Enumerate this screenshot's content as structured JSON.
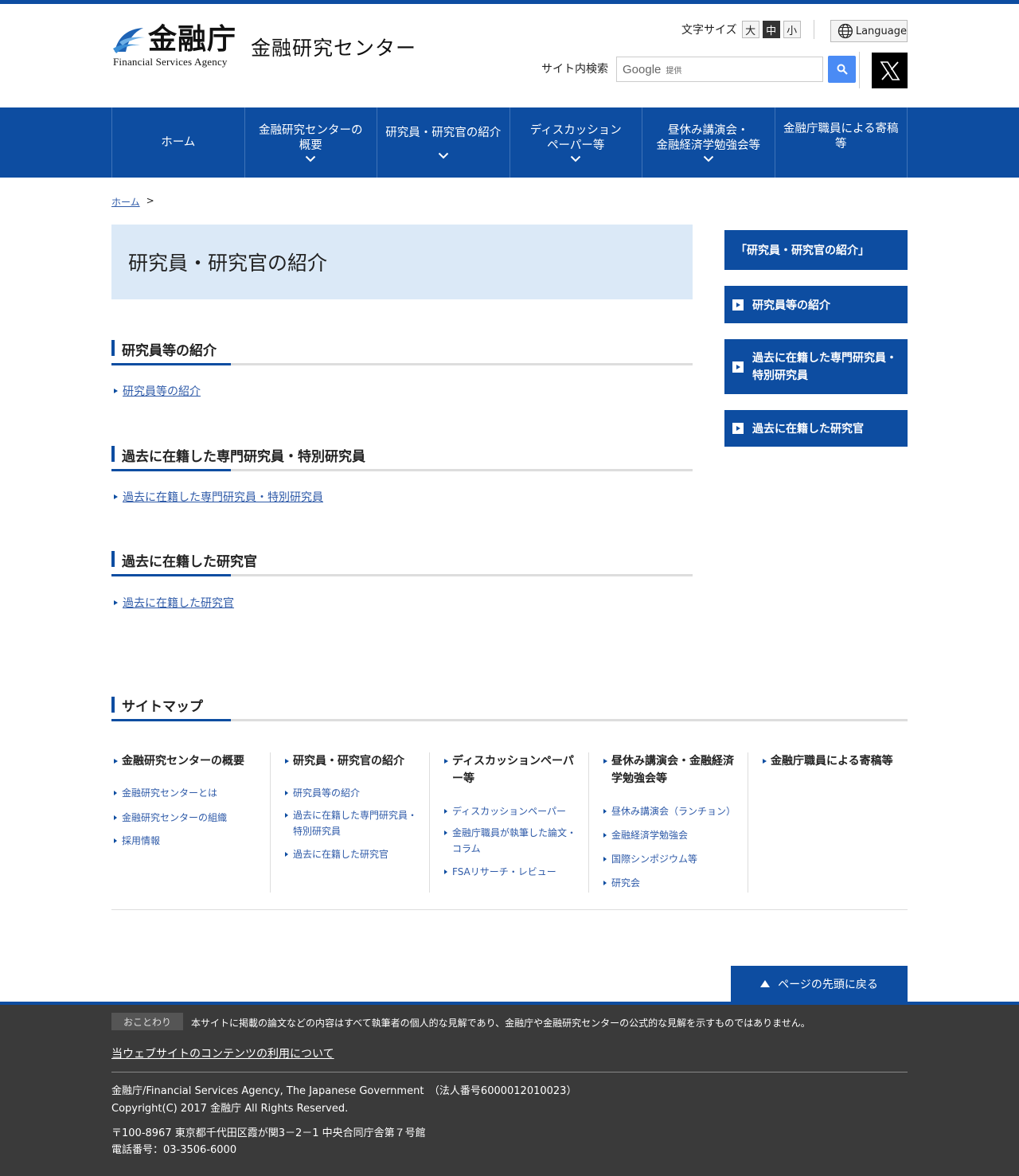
{
  "header": {
    "logo_kanji": "金融庁",
    "logo_en": "Financial Services Agency",
    "logo_center": "金融研究センター",
    "fontsize_label": "文字サイズ",
    "fontsize_options": [
      "大",
      "中",
      "小"
    ],
    "language_label": "Language",
    "search_label": "サイト内検索",
    "search_brand": "Google",
    "search_provided": "提供"
  },
  "nav": {
    "items": [
      {
        "label": "ホーム"
      },
      {
        "label": "金融研究センターの\n概要"
      },
      {
        "label": "研究員・研究官の紹介"
      },
      {
        "label": "ディスカッション\nペーパー等"
      },
      {
        "label": "昼休み講演会・\n金融経済学勉強会等"
      },
      {
        "label": "金融庁職員による寄稿\n等"
      }
    ]
  },
  "breadcrumb": {
    "home": "ホーム",
    "sep": ">"
  },
  "main": {
    "title": "研究員・研究官の紹介",
    "sections": [
      {
        "heading": "研究員等の紹介",
        "link": "研究員等の紹介"
      },
      {
        "heading": "過去に在籍した専門研究員・特別研究員",
        "link": "過去に在籍した専門研究員・特別研究員"
      },
      {
        "heading": "過去に在籍した研究官",
        "link": "過去に在籍した研究官"
      }
    ]
  },
  "sidebar": {
    "header": "「研究員・研究官の紹介」",
    "items": [
      {
        "label": "研究員等の紹介"
      },
      {
        "label": "過去に在籍した専門研究員・\n特別研究員"
      },
      {
        "label": "過去に在籍した研究官"
      }
    ]
  },
  "sitemap": {
    "title": "サイトマップ",
    "columns": [
      {
        "head": "金融研究センターの概要",
        "links": [
          "金融研究センターとは",
          "金融研究センターの組織",
          "採用情報"
        ]
      },
      {
        "head": "研究員・研究官の紹介",
        "links": [
          "研究員等の紹介",
          "過去に在籍した専門研究員・特別研究員",
          "過去に在籍した研究官"
        ]
      },
      {
        "head": "ディスカッションペーパー等",
        "links": [
          "ディスカッションペーパー",
          "金融庁職員が執筆した論文・コラム",
          "FSAリサーチ・レビュー"
        ]
      },
      {
        "head": "昼休み講演会・金融経済学勉強会等",
        "links": [
          "昼休み講演会（ランチョン）",
          "金融経済学勉強会",
          "国際シンポジウム等",
          "研究会"
        ]
      },
      {
        "head": "金融庁職員による寄稿等",
        "links": []
      }
    ]
  },
  "pagetop": "ページの先頭に戻る",
  "footer": {
    "notice_tag": "おことわり",
    "notice_text": "本サイトに掲載の論文などの内容はすべて執筆者の個人的な見解であり、金融庁や金融研究センターの公式的な見解を示すものではありません。",
    "terms": "当ウェブサイトのコンテンツの利用について",
    "org": "金融庁/Financial Services Agency, The Japanese Government　（法人番号6000012010023）",
    "copyright": "Copyright(C) 2017 金融庁 All Rights Reserved.",
    "address": "〒100-8967 東京都千代田区霞が関3－2－1 中央合同庁舎第７号館",
    "phone": "電話番号：03-3506-6000"
  },
  "colors": {
    "brand_blue": "#0d4da1",
    "title_bg": "#dbe9f7",
    "footer_bg": "#3a3a3a",
    "search_button": "#4a8bf5"
  }
}
